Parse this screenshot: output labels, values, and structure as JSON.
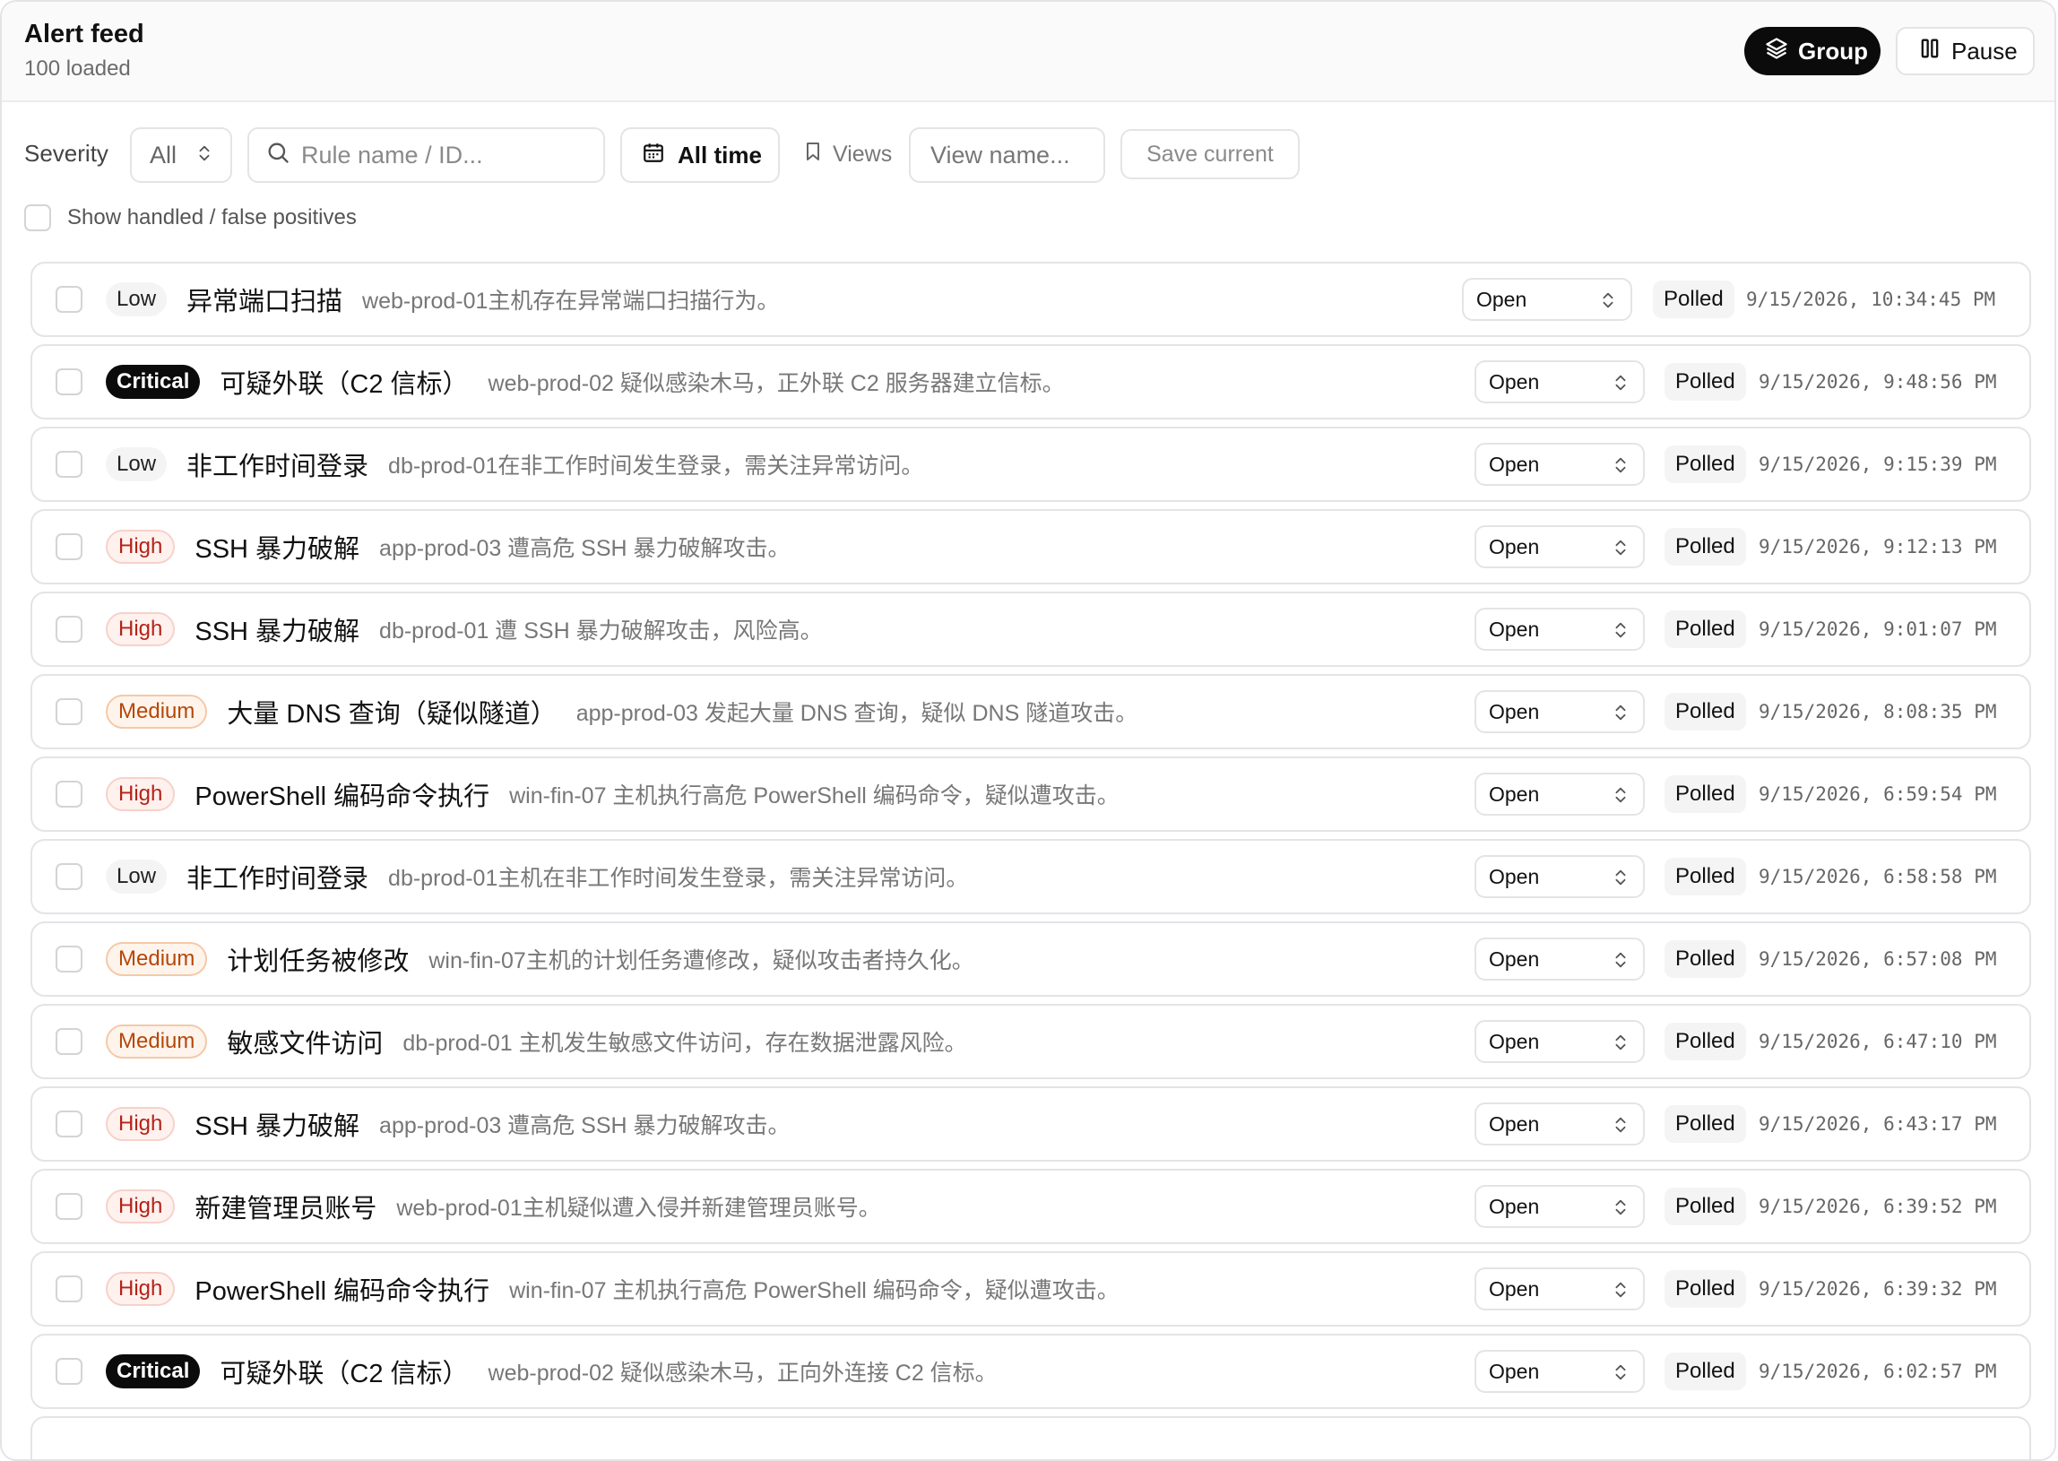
{
  "header": {
    "title": "Alert feed",
    "subtitle": "100 loaded",
    "group_label": "Group",
    "pause_label": "Pause"
  },
  "filters": {
    "severity_label": "Severity",
    "severity_value": "All",
    "search_placeholder": "Rule name / ID...",
    "time_label": "All time",
    "views_label": "Views",
    "view_name_placeholder": "View name...",
    "save_label": "Save current",
    "show_handled_label": "Show handled / false positives"
  },
  "alerts": [
    {
      "severity": "Low",
      "title": "异常端口扫描",
      "desc": "web-prod-01主机存在异常端口扫描行为。",
      "status": "Open",
      "source": "Polled",
      "time": "9/15/2026, 10:34:45 PM"
    },
    {
      "severity": "Critical",
      "title": "可疑外联（C2 信标）",
      "desc": "web-prod-02 疑似感染木马，正外联 C2 服务器建立信标。",
      "status": "Open",
      "source": "Polled",
      "time": "9/15/2026, 9:48:56 PM"
    },
    {
      "severity": "Low",
      "title": "非工作时间登录",
      "desc": "db-prod-01在非工作时间发生登录，需关注异常访问。",
      "status": "Open",
      "source": "Polled",
      "time": "9/15/2026, 9:15:39 PM"
    },
    {
      "severity": "High",
      "title": "SSH 暴力破解",
      "desc": "app-prod-03 遭高危 SSH 暴力破解攻击。",
      "status": "Open",
      "source": "Polled",
      "time": "9/15/2026, 9:12:13 PM"
    },
    {
      "severity": "High",
      "title": "SSH 暴力破解",
      "desc": "db-prod-01 遭 SSH 暴力破解攻击，风险高。",
      "status": "Open",
      "source": "Polled",
      "time": "9/15/2026, 9:01:07 PM"
    },
    {
      "severity": "Medium",
      "title": "大量 DNS 查询（疑似隧道）",
      "desc": "app-prod-03 发起大量 DNS 查询，疑似 DNS 隧道攻击。",
      "status": "Open",
      "source": "Polled",
      "time": "9/15/2026, 8:08:35 PM"
    },
    {
      "severity": "High",
      "title": "PowerShell 编码命令执行",
      "desc": "win-fin-07 主机执行高危 PowerShell 编码命令，疑似遭攻击。",
      "status": "Open",
      "source": "Polled",
      "time": "9/15/2026, 6:59:54 PM"
    },
    {
      "severity": "Low",
      "title": "非工作时间登录",
      "desc": "db-prod-01主机在非工作时间发生登录，需关注异常访问。",
      "status": "Open",
      "source": "Polled",
      "time": "9/15/2026, 6:58:58 PM"
    },
    {
      "severity": "Medium",
      "title": "计划任务被修改",
      "desc": "win-fin-07主机的计划任务遭修改，疑似攻击者持久化。",
      "status": "Open",
      "source": "Polled",
      "time": "9/15/2026, 6:57:08 PM"
    },
    {
      "severity": "Medium",
      "title": "敏感文件访问",
      "desc": "db-prod-01 主机发生敏感文件访问，存在数据泄露风险。",
      "status": "Open",
      "source": "Polled",
      "time": "9/15/2026, 6:47:10 PM"
    },
    {
      "severity": "High",
      "title": "SSH 暴力破解",
      "desc": "app-prod-03 遭高危 SSH 暴力破解攻击。",
      "status": "Open",
      "source": "Polled",
      "time": "9/15/2026, 6:43:17 PM"
    },
    {
      "severity": "High",
      "title": "新建管理员账号",
      "desc": "web-prod-01主机疑似遭入侵并新建管理员账号。",
      "status": "Open",
      "source": "Polled",
      "time": "9/15/2026, 6:39:52 PM"
    },
    {
      "severity": "High",
      "title": "PowerShell 编码命令执行",
      "desc": "win-fin-07 主机执行高危 PowerShell 编码命令，疑似遭攻击。",
      "status": "Open",
      "source": "Polled",
      "time": "9/15/2026, 6:39:32 PM"
    },
    {
      "severity": "Critical",
      "title": "可疑外联（C2 信标）",
      "desc": "web-prod-02 疑似感染木马，正向外连接 C2 信标。",
      "status": "Open",
      "source": "Polled",
      "time": "9/15/2026, 6:02:57 PM"
    }
  ],
  "icons": {
    "group": "layers-icon",
    "pause": "pause-icon",
    "search": "search-icon",
    "calendar": "calendar-icon",
    "views": "bookmark-icon",
    "select": "chevron-up-down-icon"
  }
}
